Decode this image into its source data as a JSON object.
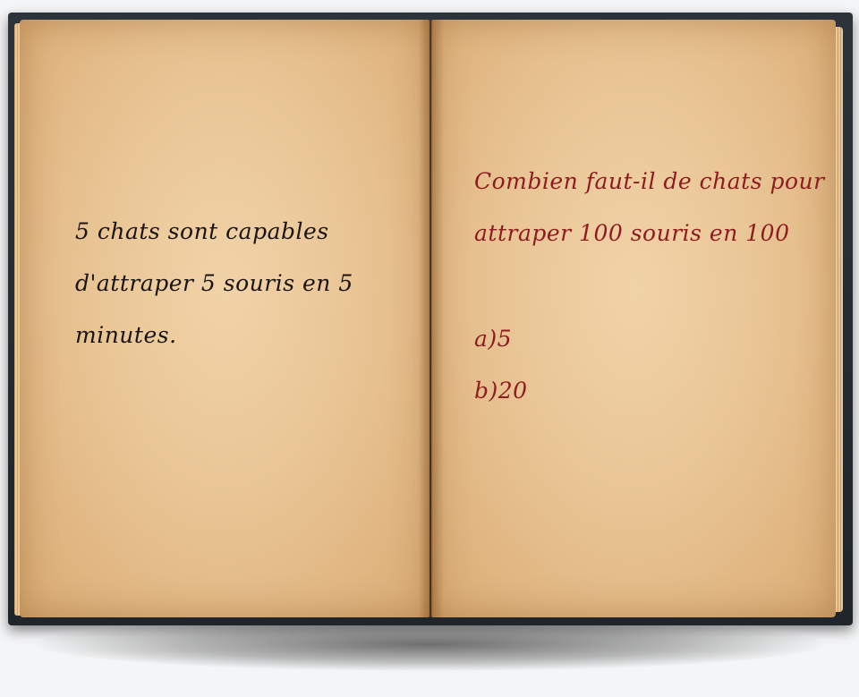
{
  "left_page": {
    "lines": [
      "5 chats sont capables",
      "d'attraper 5 souris en 5",
      "minutes."
    ]
  },
  "right_page": {
    "question_lines": [
      "Combien faut-il de chats pour",
      "attraper 100 souris en 100"
    ],
    "answers": [
      "a)5",
      "b)20"
    ]
  },
  "colors": {
    "left_ink": "#1a1410",
    "right_ink": "#8e1b1f",
    "cover": "#2c333a",
    "paper": "#e9c595"
  }
}
